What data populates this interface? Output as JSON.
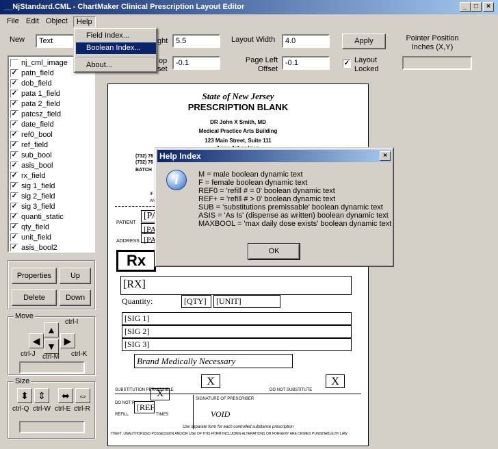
{
  "window": {
    "title": "__NjStandard.CML - ChartMaker Clinical Prescription Layout Editor"
  },
  "menu": [
    "File",
    "Edit",
    "Object",
    "Help"
  ],
  "help_menu": {
    "items": [
      "Field Index...",
      "Boolean Index...",
      "About..."
    ]
  },
  "toolbar": {
    "new_label": "New",
    "new_value": "Text",
    "height_label": "ght",
    "height_value": "5.5",
    "layout_width_label": "Layout Width",
    "layout_width_value": "4.0",
    "apply_label": "Apply",
    "pointer_label": "Pointer Position Inches (X,Y)",
    "pointer_value": "",
    "top_label_1": "op",
    "top_label_2": "set",
    "top_value": "-0.1",
    "page_left_label": "Page Left Offset",
    "page_left_value": "-0.1",
    "layout_locked_label": "Layout Locked",
    "layout_locked": true
  },
  "fields": [
    {
      "name": "nj_cml_image",
      "checked": false
    },
    {
      "name": "patn_field",
      "checked": true
    },
    {
      "name": "dob_field",
      "checked": true
    },
    {
      "name": "pata 1_field",
      "checked": true
    },
    {
      "name": "pata 2_field",
      "checked": true
    },
    {
      "name": "patcsz_field",
      "checked": true
    },
    {
      "name": "date_field",
      "checked": true
    },
    {
      "name": "ref0_bool",
      "checked": true
    },
    {
      "name": "ref_field",
      "checked": true
    },
    {
      "name": "sub_bool",
      "checked": true
    },
    {
      "name": "asis_bool",
      "checked": true
    },
    {
      "name": "rx_field",
      "checked": true
    },
    {
      "name": "sig 1_field",
      "checked": true
    },
    {
      "name": "sig 2_field",
      "checked": true
    },
    {
      "name": "sig 3_field",
      "checked": true
    },
    {
      "name": "quanti_static",
      "checked": true
    },
    {
      "name": "qty_field",
      "checked": true
    },
    {
      "name": "unit_field",
      "checked": true
    },
    {
      "name": "asis_bool2",
      "checked": true
    }
  ],
  "buttons": {
    "properties": "Properties",
    "up": "Up",
    "delete": "Delete",
    "down": "Down"
  },
  "move": {
    "label": "Move",
    "up_key": "ctrl-I",
    "left_key": "ctrl-J",
    "down_key": "ctrl-M",
    "right_key": "ctrl-K"
  },
  "size": {
    "label": "Size",
    "k1": "ctrl-Q",
    "k2": "ctrl-W",
    "k3": "ctrl-E",
    "k4": "ctrl-R"
  },
  "form": {
    "state": "State of New Jersey",
    "title": "PRESCRIPTION BLANK",
    "doctor": "DR John X Smith, MD",
    "practice": "Medical Practice Arts Building",
    "street": "123 Main Street, Suite 111",
    "street2": "Anne Arbor Iowa",
    "phone1": "(732) 76",
    "phone2": "(732) 76",
    "batch": "BATCH",
    "if_text": "IF",
    "an_text": "AN",
    "patient": "PATIENT",
    "address": "ADDRESS",
    "pa1": "[PA",
    "pa2": "[PA",
    "pa3": "[PA",
    "rx_logo": "Rx",
    "rx_field": "[RX]",
    "quantity": "Quantity:",
    "qty": "[QTY]",
    "unit": "[UNIT]",
    "sig1": "[SIG 1]",
    "sig2": "[SIG 2]",
    "sig3": "[SIG 3]",
    "brand": "Brand Medically Necessary",
    "x_mark": "X",
    "sub_perm": "SUBSTITUTION PERMISSIBLE",
    "do_not_sub": "DO NOT SUBSTITUTE",
    "do_not_ref": "DO NOT R",
    "refill": "REFILL",
    "times": "TIMES",
    "ref_box": "[REF",
    "signature": "SIGNATURE OF PRESCRIBER",
    "void": "VOID",
    "note1": "Use separate form for each controlled substance prescription",
    "note2": "THEFT, UNAUTHORIZED POSSESSION AND/OR USE OF THIS FORM INCLUDING ALTERATIONS OR FORGERY ARE CRIMES PUNISHABLE BY LAW"
  },
  "dialog": {
    "title": "Help Index",
    "lines": [
      "M = male boolean dynamic text",
      "F = female boolean dynamic text",
      "REF0 = 'refill # = 0' boolean dynamic text",
      "REF+ = 'refill # > 0' boolean dynamic text",
      "SUB = 'substitutions premissable' boolean dynamic text",
      "ASIS = 'As Is' (dispense as written) boolean dynamic text",
      "MAXBOOL = 'max daily dose exists' boolean dynamic text"
    ],
    "ok": "OK"
  }
}
